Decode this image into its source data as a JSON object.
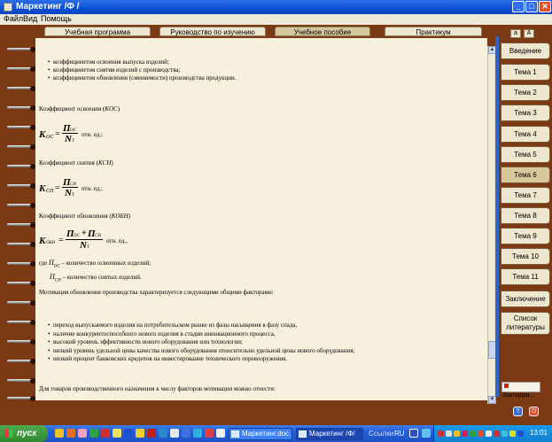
{
  "window": {
    "title": "Маркетинг /Ф /",
    "menu": [
      "Файл",
      "Вид",
      "Помощь"
    ]
  },
  "top_tabs": [
    {
      "label": "Учебная программа",
      "active": false
    },
    {
      "label": "Руководство по изучению",
      "active": false
    },
    {
      "label": "Учебное пособие",
      "active": true
    },
    {
      "label": "Практикум",
      "active": false
    }
  ],
  "font_buttons": [
    "a",
    "A"
  ],
  "content": {
    "bullets_top": [
      "коэффициентом освоения выпуска изделий;",
      "коэффициентом снятия изделий с производства;",
      "коэффициентом обновления (сменяемости) производства продукции."
    ],
    "coef_osv_label": "Коэффициент освоения (",
    "coef_osv_symbol": "KOC",
    "coef_osv_close": ")",
    "formula1": {
      "lhs": "K",
      "lhs_sub": "OC",
      "num": "П",
      "num_sub": "OC",
      "den": "N",
      "den_sub": "T",
      "unit": "отн. ед.;"
    },
    "coef_sn_label": "Коэффициент снятия (",
    "coef_sn_symbol": "KCH",
    "coef_sn_close": ")",
    "formula2": {
      "lhs": "K",
      "lhs_sub": "CH",
      "num": "П",
      "num_sub": "CH",
      "den": "N",
      "den_sub": "T",
      "unit": "отн. ед.;"
    },
    "coef_obn_label": "Коэффициент обновления (",
    "coef_obn_symbol": "KOБH",
    "coef_obn_close": ")",
    "formula3": {
      "lhs": "K",
      "lhs_sub": "OБH",
      "num_a": "П",
      "num_a_sub": "OC",
      "plus": "+",
      "num_b": "П",
      "num_b_sub": "CH",
      "den": "N",
      "den_sub": "T",
      "unit": "отн. ед.,"
    },
    "where_prefix": "где",
    "where1_sym": "П",
    "where1_sub": "OC",
    "where1_text": "– количество освоенных изделий;",
    "where2_sym": "П",
    "where2_sub": "CH",
    "where2_text": "– количество снятых изделий.",
    "motivation_intro": "Мотивация обновления производства характеризуется следующими общими факторами:",
    "bullets_bottom": [
      "переход выпускаемого изделия на потребительском рынке из фазы насыщения в фазу спада,",
      "наличие конкурентоспособного нового изделия в стадии инновационного процесса,",
      "высокий уровень эффективности нового оборудования или технологии;",
      "низкий уровень удельной цены качества нового оборудования относительно удельной цены нового оборудования;",
      "низкий процент банковских кредитов на инвестирование технического перевооружения."
    ],
    "last_paragraph": "Для товаров производственного назначения к числу факторов мотивации можно отнести:"
  },
  "side_tabs": [
    {
      "label": "Введение",
      "active": false
    },
    {
      "label": "Тема 1",
      "active": false
    },
    {
      "label": "Тема 2",
      "active": false
    },
    {
      "label": "Тема 3",
      "active": false
    },
    {
      "label": "Тема 4",
      "active": false
    },
    {
      "label": "Тема 5",
      "active": false
    },
    {
      "label": "Тема 6",
      "active": true
    },
    {
      "label": "Тема 7",
      "active": false
    },
    {
      "label": "Тема 8",
      "active": false
    },
    {
      "label": "Тема 9",
      "active": false
    },
    {
      "label": "Тема 10",
      "active": false
    },
    {
      "label": "Тема 11",
      "active": false
    },
    {
      "label": "Заключение",
      "active": false
    },
    {
      "label": "Список литературы",
      "active": false
    }
  ],
  "bookmarks_label": "Закладки...",
  "taskbar": {
    "start_label": "пуск",
    "buttons": [
      {
        "label": "Маркетинг.doc...",
        "active": false
      },
      {
        "label": "Маркетинг /Ф/",
        "active": true
      }
    ],
    "links_label": "Ссылки",
    "lang": "RU",
    "clock": "13:01"
  }
}
